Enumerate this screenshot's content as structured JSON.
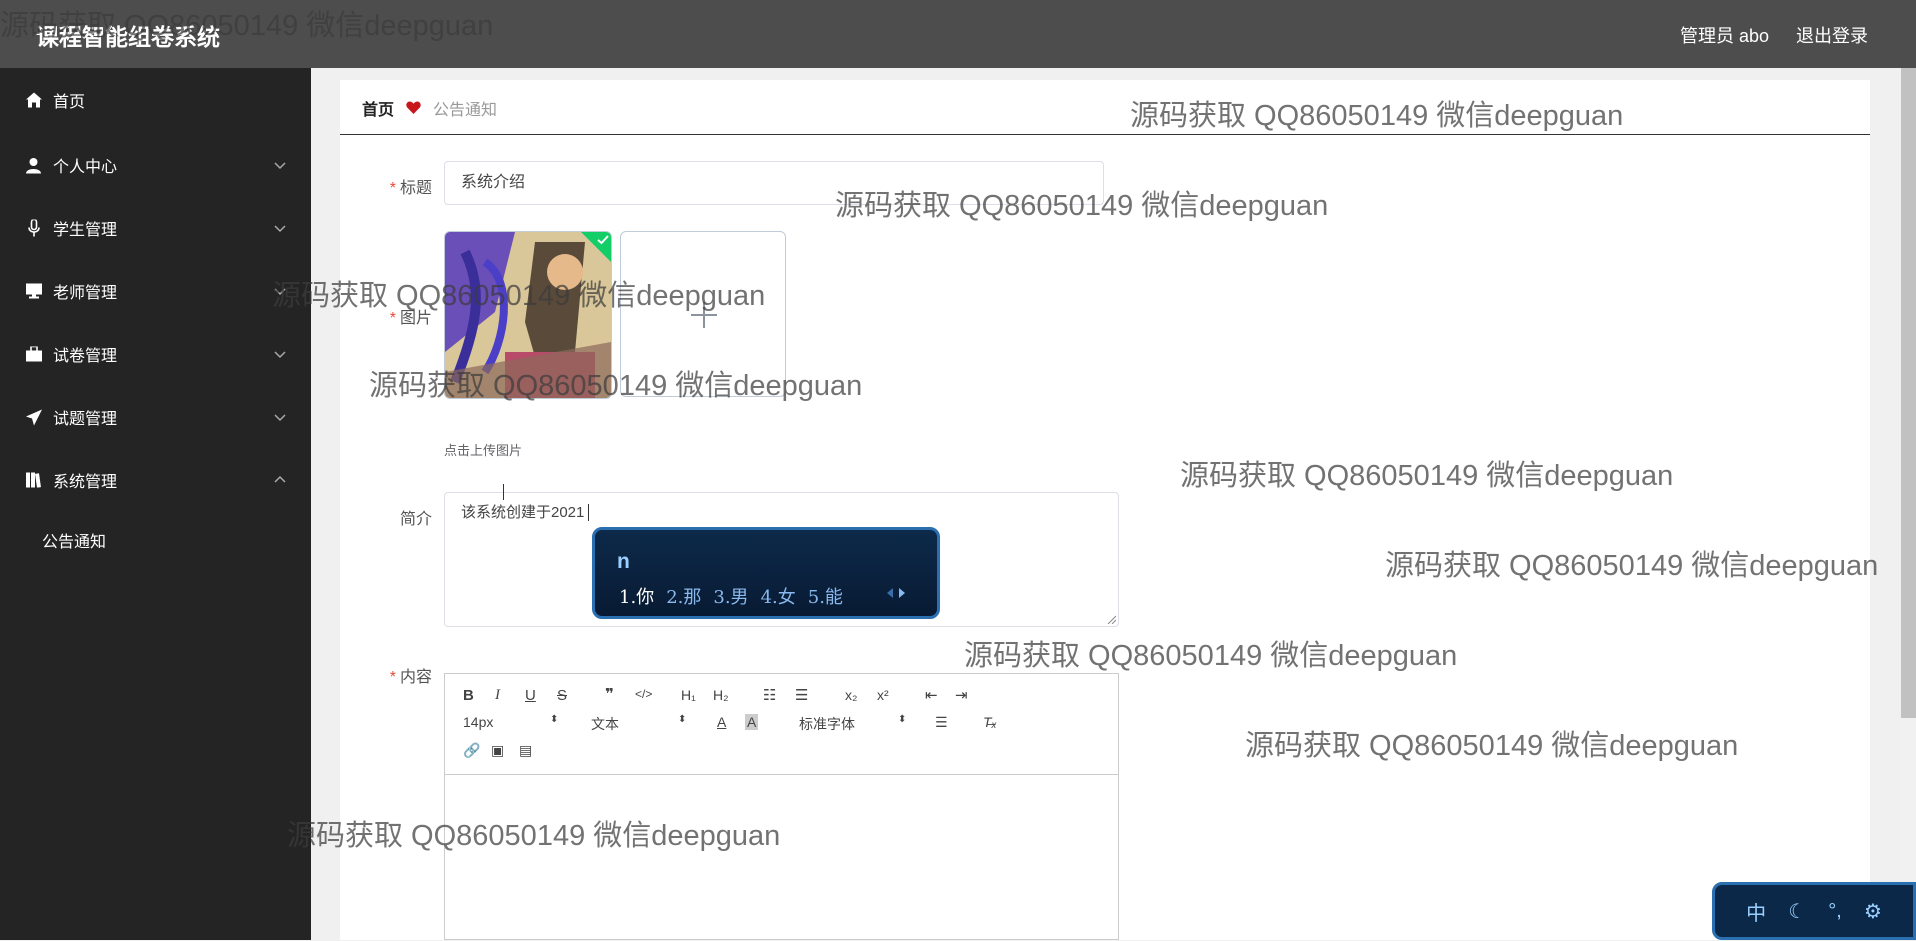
{
  "app": {
    "title": "课程智能组卷系统"
  },
  "header": {
    "user_label": "管理员 abo",
    "logout_label": "退出登录"
  },
  "sidebar": {
    "items": [
      {
        "label": "首页",
        "icon": "home-icon"
      },
      {
        "label": "个人中心",
        "icon": "user-icon"
      },
      {
        "label": "学生管理",
        "icon": "microphone-icon"
      },
      {
        "label": "老师管理",
        "icon": "monitor-icon"
      },
      {
        "label": "试卷管理",
        "icon": "briefcase-icon"
      },
      {
        "label": "试题管理",
        "icon": "paper-plane-icon"
      },
      {
        "label": "系统管理",
        "icon": "books-icon"
      }
    ],
    "sub_items": [
      {
        "label": "公告通知"
      }
    ]
  },
  "breadcrumb": {
    "home": "首页",
    "current": "公告通知"
  },
  "form": {
    "title_label": "标题",
    "title_value": "系统介绍",
    "image_label": "图片",
    "upload_tip": "点击上传图片",
    "intro_label": "简介",
    "intro_value": "该系统创建于2021",
    "content_label": "内容"
  },
  "ime": {
    "typed": "n",
    "candidates": [
      "1.你",
      "2.那",
      "3.男",
      "4.女",
      "5.能"
    ]
  },
  "editor": {
    "font_size": "14px",
    "paragraph": "文本",
    "font_family": "标准字体"
  },
  "ime_status": {
    "mode": "中"
  },
  "watermark": "源码获取 QQ86050149 微信deepguan"
}
